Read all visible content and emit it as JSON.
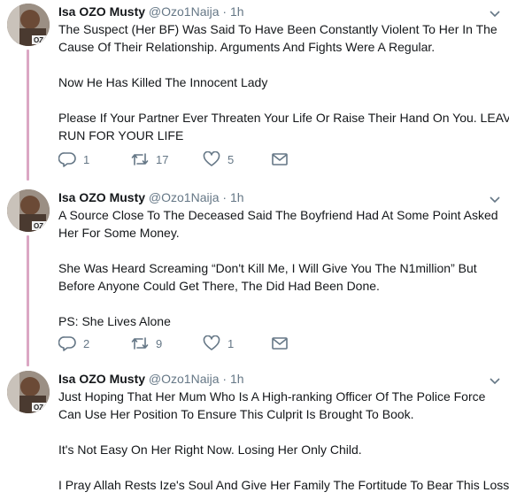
{
  "tweets": [
    {
      "name": "Isa OZO Musty",
      "handle": "@Ozo1Naija",
      "dot": "·",
      "time": "1h",
      "lines": [
        "The Suspect (Her BF) Was Said To Have Been Constantly Violent To Her In The",
        "Cause Of Their Relationship. Arguments And Fights Were A Regular.",
        "Now He Has Killed The Innocent Lady",
        "Please If Your Partner Ever Threaten Your Life Or Raise Their Hand On You. LEAVE.",
        "RUN FOR YOUR LIFE"
      ],
      "replies": "1",
      "retweets": "17",
      "likes": "5"
    },
    {
      "name": "Isa OZO Musty",
      "handle": "@Ozo1Naija",
      "dot": "·",
      "time": "1h",
      "lines": [
        "A Source Close To The Deceased Said The Boyfriend Had At Some Point Asked",
        "Her For Some Money.",
        "She Was Heard Screaming “Don't Kill Me, I Will Give You The N1million” But",
        "Before Anyone Could Get There, The Did Had Been Done.",
        "PS: She Lives Alone"
      ],
      "replies": "2",
      "retweets": "9",
      "likes": "1"
    },
    {
      "name": "Isa OZO Musty",
      "handle": "@Ozo1Naija",
      "dot": "·",
      "time": "1h",
      "lines": [
        "Just Hoping That Her Mum Who Is A High-ranking Officer Of The Police Force",
        "Can Use Her Position To Ensure This Culprit Is Brought To Book.",
        "It's Not Easy On Her Right Now. Losing Her Only Child.",
        "I Pray Allah Rests Ize's Soul And Give Her Family The Fortitude To Bear This Loss."
      ]
    }
  ],
  "colors": {
    "thread_line": "#dba7c4",
    "muted": "#657786",
    "text": "#14171a"
  },
  "icons": [
    "reply-icon",
    "retweet-icon",
    "like-icon",
    "message-icon",
    "chevron-down-icon"
  ]
}
